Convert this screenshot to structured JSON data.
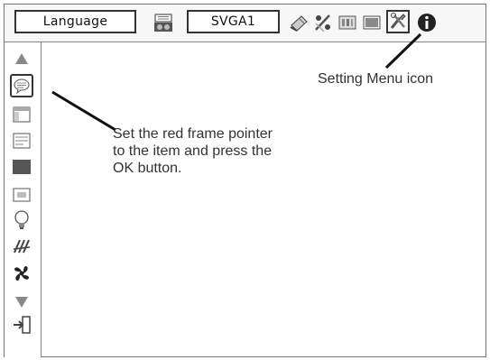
{
  "toolbar": {
    "language_label": "Language",
    "signal_label": "SVGA1",
    "icons": [
      "input-icon",
      "pc-adjust-icon",
      "image-select-icon",
      "image-adjust-icon",
      "screen-icon",
      "setting-icon",
      "information-icon"
    ]
  },
  "sidebar": {
    "icons": [
      "scroll-up-icon",
      "language-menu-icon",
      "menu-position-icon",
      "display-settings-icon",
      "background-icon",
      "logo-icon",
      "lamp-icon",
      "filter-icon",
      "fan-icon",
      "scroll-down-icon",
      "exit-icon"
    ]
  },
  "annotations": {
    "setting_menu": "Setting Menu icon",
    "pointer_line1": "Set the red frame pointer",
    "pointer_line2": "to the item and press the",
    "pointer_line3": "OK button."
  }
}
